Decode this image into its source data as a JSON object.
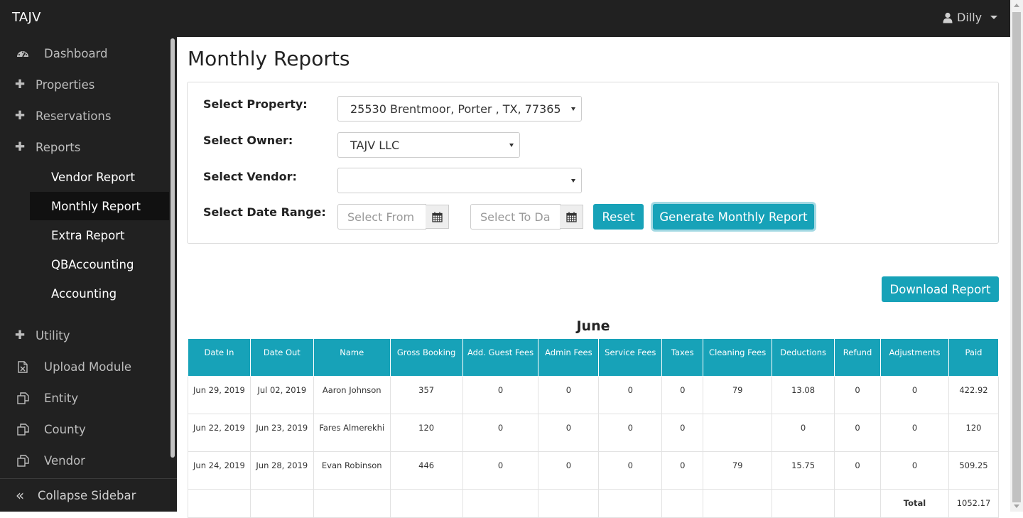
{
  "app": {
    "brand": "TAJV",
    "user_name": "Dilly"
  },
  "sidebar": {
    "items": [
      {
        "label": "Dashboard",
        "icon": "dashboard-gauge-icon"
      },
      {
        "label": "Properties",
        "icon": "plus-icon"
      },
      {
        "label": "Reservations",
        "icon": "plus-icon"
      },
      {
        "label": "Reports",
        "icon": "plus-icon"
      }
    ],
    "report_subitems": [
      {
        "label": "Vendor Report"
      },
      {
        "label": "Monthly Report",
        "active": true
      },
      {
        "label": "Extra Report"
      },
      {
        "label": "QBAccounting"
      },
      {
        "label": "Accounting"
      }
    ],
    "lower_items": [
      {
        "label": "Utility",
        "icon": "plus-icon"
      },
      {
        "label": "Upload Module",
        "icon": "file-excel-icon"
      },
      {
        "label": "Entity",
        "icon": "copy-icon"
      },
      {
        "label": "County",
        "icon": "copy-icon"
      },
      {
        "label": "Vendor",
        "icon": "copy-icon"
      }
    ],
    "collapse_label": "Collapse Sidebar"
  },
  "page": {
    "title": "Monthly Reports",
    "filters": {
      "property_label": "Select Property:",
      "property_value": "25530 Brentmoor, Porter , TX, 77365",
      "owner_label": "Select Owner:",
      "owner_value": "TAJV LLC",
      "vendor_label": "Select Vendor:",
      "vendor_value": "",
      "date_range_label": "Select Date Range:",
      "from_placeholder": "Select From",
      "to_placeholder": "Select To Da",
      "reset_label": "Reset",
      "generate_label": "Generate Monthly Report"
    },
    "download_label": "Download Report",
    "month": "June",
    "table": {
      "headers": [
        "Date In",
        "Date Out",
        "Name",
        "Gross Booking",
        "Add. Guest Fees",
        "Admin Fees",
        "Service Fees",
        "Taxes",
        "Cleaning Fees",
        "Deductions",
        "Refund",
        "Adjustments",
        "Paid"
      ],
      "rows": [
        [
          "Jun 29, 2019",
          "Jul 02, 2019",
          "Aaron Johnson",
          "357",
          "0",
          "0",
          "0",
          "0",
          "79",
          "13.08",
          "0",
          "0",
          "422.92"
        ],
        [
          "Jun 22, 2019",
          "Jun 23, 2019",
          "Fares Almerekhi",
          "120",
          "0",
          "0",
          "0",
          "0",
          "",
          "0",
          "0",
          "0",
          "120"
        ],
        [
          "Jun 24, 2019",
          "Jun 28, 2019",
          "Evan Robinson",
          "446",
          "0",
          "0",
          "0",
          "0",
          "79",
          "15.75",
          "0",
          "0",
          "509.25"
        ]
      ],
      "total_label": "Total",
      "total_value": "1052.17"
    }
  },
  "colors": {
    "accent": "#17a2b8",
    "sidebar_bg": "#212121",
    "active_bg": "#111111"
  }
}
